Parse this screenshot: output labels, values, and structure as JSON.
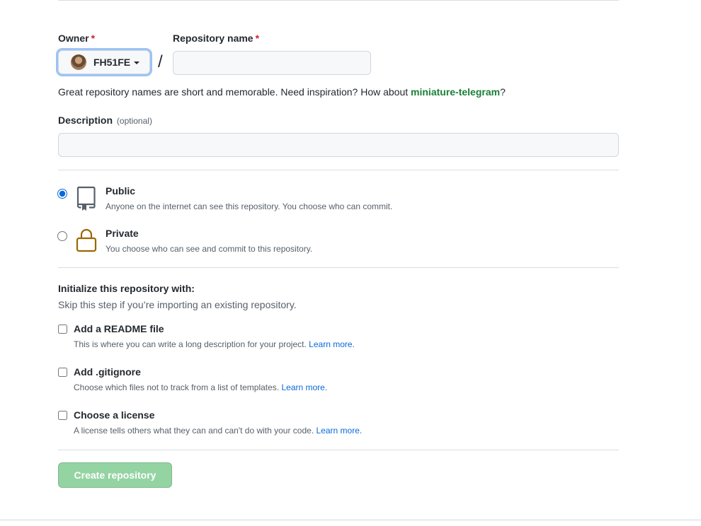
{
  "owner": {
    "label": "Owner",
    "required_mark": "*",
    "selected": "FH51FE"
  },
  "repo_name": {
    "label": "Repository name",
    "required_mark": "*",
    "value": "",
    "separator": "/"
  },
  "hint": {
    "prefix": "Great repository names are short and memorable. Need inspiration? How about ",
    "suggestion": "miniature-telegram",
    "suffix": "?"
  },
  "description": {
    "label": "Description",
    "optional": "(optional)",
    "value": ""
  },
  "visibility": {
    "selected": "public",
    "options": [
      {
        "title": "Public",
        "desc": "Anyone on the internet can see this repository. You choose who can commit.",
        "icon": "repo-book-icon"
      },
      {
        "title": "Private",
        "desc": "You choose who can see and commit to this repository.",
        "icon": "lock-icon"
      }
    ]
  },
  "init": {
    "title": "Initialize this repository with:",
    "subtitle": "Skip this step if you’re importing an existing repository.",
    "options": [
      {
        "title": "Add a README file",
        "desc": "This is where you can write a long description for your project.",
        "link": "Learn more."
      },
      {
        "title": "Add .gitignore",
        "desc": "Choose which files not to track from a list of templates.",
        "link": "Learn more."
      },
      {
        "title": "Choose a license",
        "desc": "A license tells others what they can and can't do with your code.",
        "link": "Learn more."
      }
    ]
  },
  "create_button": "Create repository",
  "colors": {
    "accent": "#0969da",
    "suggestion": "#1a7f37",
    "create_disabled": "#94d3a2",
    "lock": "#9a6700"
  }
}
